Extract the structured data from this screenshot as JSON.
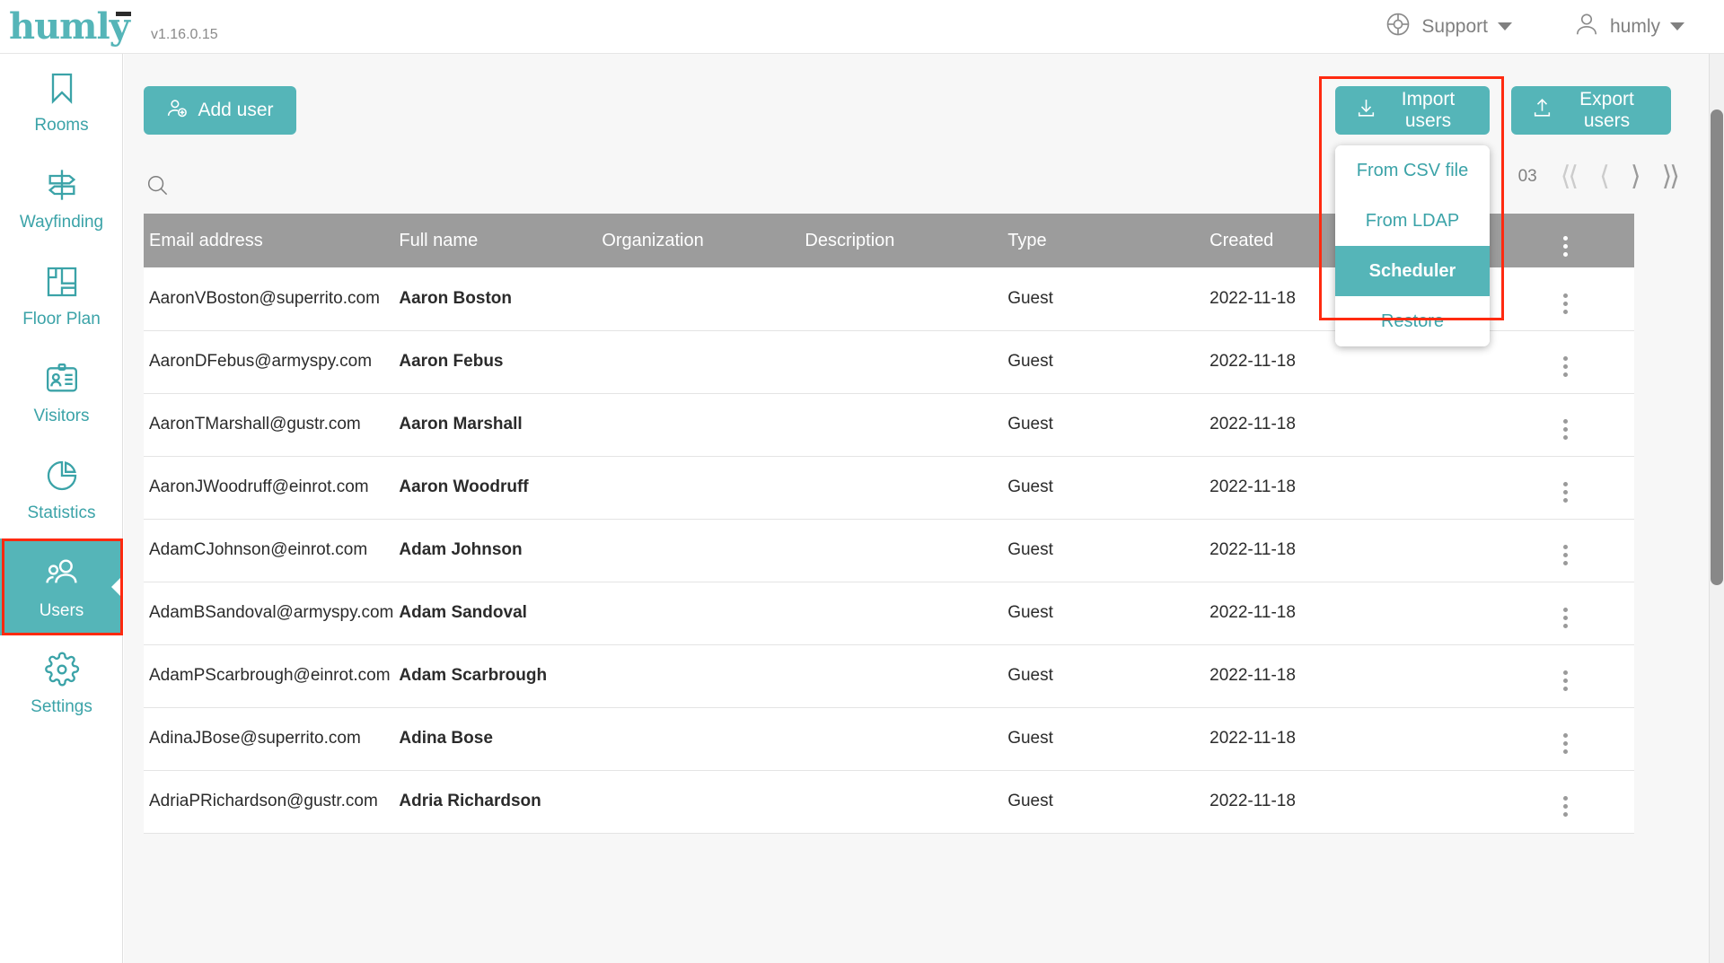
{
  "header": {
    "logo_text": "humly",
    "version": "v1.16.0.15",
    "support_label": "Support",
    "support_icon": "lifebuoy-icon",
    "user_label": "humly",
    "user_icon": "person-icon",
    "caret_icon": "chevron-down-icon"
  },
  "sidebar": {
    "items": [
      {
        "label": "Rooms",
        "icon": "bookmark-icon",
        "active": false
      },
      {
        "label": "Wayfinding",
        "icon": "signpost-icon",
        "active": false
      },
      {
        "label": "Floor Plan",
        "icon": "floorplan-icon",
        "active": false
      },
      {
        "label": "Visitors",
        "icon": "badge-icon",
        "active": false
      },
      {
        "label": "Statistics",
        "icon": "piechart-icon",
        "active": false
      },
      {
        "label": "Users",
        "icon": "users-icon",
        "active": true
      },
      {
        "label": "Settings",
        "icon": "gear-icon",
        "active": false
      }
    ]
  },
  "toolbar": {
    "add_user_label": "Add user",
    "add_user_icon": "person-add-icon",
    "import_users_label": "Import users",
    "import_users_icon": "download-arrow-icon",
    "export_users_label": "Export users",
    "export_users_icon": "upload-arrow-icon"
  },
  "import_dropdown": {
    "open": true,
    "items": [
      {
        "label": "From CSV file",
        "selected": false
      },
      {
        "label": "From LDAP",
        "selected": false
      },
      {
        "label": "Scheduler",
        "selected": true
      },
      {
        "label": "Restore",
        "selected": false
      }
    ]
  },
  "search": {
    "icon": "search-icon",
    "value": "",
    "placeholder": ""
  },
  "pagination": {
    "info": "03",
    "first_icon": "⟨⟨",
    "prev_icon": "⟨",
    "next_icon": "⟩",
    "last_icon": "⟩⟩"
  },
  "table": {
    "columns": [
      "Email address",
      "Full name",
      "Organization",
      "Description",
      "Type",
      "Created",
      ""
    ],
    "menu_icon": "kebab-menu-icon",
    "rows": [
      {
        "email": "AaronVBoston@superrito.com",
        "name": "Aaron Boston",
        "org": "",
        "desc": "",
        "type": "Guest",
        "created": "2022-11-18"
      },
      {
        "email": "AaronDFebus@armyspy.com",
        "name": "Aaron Febus",
        "org": "",
        "desc": "",
        "type": "Guest",
        "created": "2022-11-18"
      },
      {
        "email": "AaronTMarshall@gustr.com",
        "name": "Aaron Marshall",
        "org": "",
        "desc": "",
        "type": "Guest",
        "created": "2022-11-18"
      },
      {
        "email": "AaronJWoodruff@einrot.com",
        "name": "Aaron Woodruff",
        "org": "",
        "desc": "",
        "type": "Guest",
        "created": "2022-11-18"
      },
      {
        "email": "AdamCJohnson@einrot.com",
        "name": "Adam Johnson",
        "org": "",
        "desc": "",
        "type": "Guest",
        "created": "2022-11-18"
      },
      {
        "email": "AdamBSandoval@armyspy.com",
        "name": "Adam Sandoval",
        "org": "",
        "desc": "",
        "type": "Guest",
        "created": "2022-11-18"
      },
      {
        "email": "AdamPScarbrough@einrot.com",
        "name": "Adam Scarbrough",
        "org": "",
        "desc": "",
        "type": "Guest",
        "created": "2022-11-18"
      },
      {
        "email": "AdinaJBose@superrito.com",
        "name": "Adina Bose",
        "org": "",
        "desc": "",
        "type": "Guest",
        "created": "2022-11-18"
      },
      {
        "email": "AdriaPRichardson@gustr.com",
        "name": "Adria Richardson",
        "org": "",
        "desc": "",
        "type": "Guest",
        "created": "2022-11-18"
      }
    ]
  },
  "colors": {
    "brand": "#55b5b8",
    "brand_text": "#3ba3a8",
    "header_row": "#9c9c9c",
    "highlight": "#ff2a10",
    "page_bg": "#f7f7f7"
  }
}
